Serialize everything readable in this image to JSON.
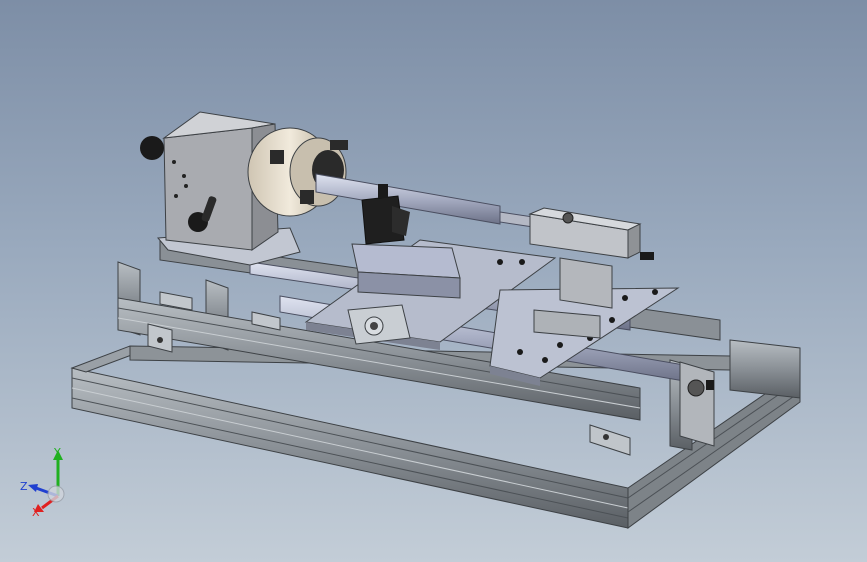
{
  "triad": {
    "x_label": "X",
    "y_label": "Y",
    "z_label": "Z",
    "colors": {
      "x": "#e02020",
      "y": "#20b020",
      "z": "#2040d0"
    }
  },
  "theme": {
    "frame_light": "#aab0b5",
    "frame_mid": "#8a9096",
    "frame_dark": "#4c5156",
    "plate": "#b9bfd0",
    "housing": "#a7a9ad",
    "chuck": "#e6ddce",
    "black": "#1a1a1a"
  }
}
